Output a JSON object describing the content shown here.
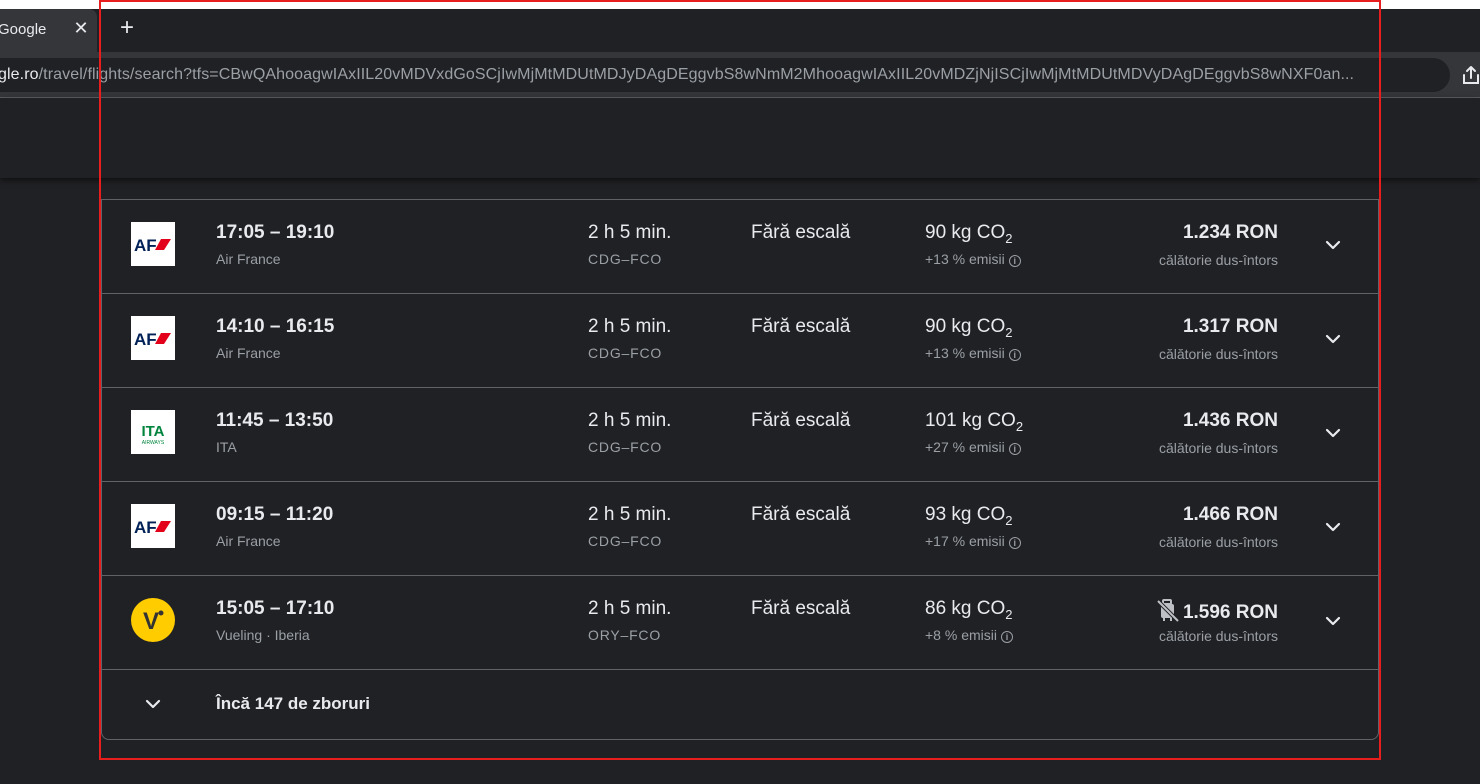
{
  "browser": {
    "tab_title": "Google",
    "tab_close": "✕",
    "new_tab": "+",
    "url_host": "gle.ro",
    "url_path": "/travel/flights/search?tfs=CBwQAhooagwIAxIIL20vMDVxdGoSCjIwMjMtMDUtMDJyDAgDEggvbS8wNmM2MhooagwIAxIIL20vMDZjNjISCjIwMjMtMDUtMDVyDAgDEggvbS8wNXF0an..."
  },
  "flights": [
    {
      "logo": "air-france",
      "times": "17:05 – 19:10",
      "airline": "Air France",
      "duration": "2 h 5 min.",
      "route": "CDG–FCO",
      "stops": "Fără escală",
      "emission_value": "90 kg CO",
      "emission_sub": "2",
      "emission_pct": "+13 % emisii",
      "price": "1.234 RON",
      "price_note": "călătorie dus-întors",
      "no_bag": false
    },
    {
      "logo": "air-france",
      "times": "14:10 – 16:15",
      "airline": "Air France",
      "duration": "2 h 5 min.",
      "route": "CDG–FCO",
      "stops": "Fără escală",
      "emission_value": "90 kg CO",
      "emission_sub": "2",
      "emission_pct": "+13 % emisii",
      "price": "1.317 RON",
      "price_note": "călătorie dus-întors",
      "no_bag": false
    },
    {
      "logo": "ita-airways",
      "times": "11:45 – 13:50",
      "airline": "ITA",
      "duration": "2 h 5 min.",
      "route": "CDG–FCO",
      "stops": "Fără escală",
      "emission_value": "101 kg CO",
      "emission_sub": "2",
      "emission_pct": "+27 % emisii",
      "price": "1.436 RON",
      "price_note": "călătorie dus-întors",
      "no_bag": false
    },
    {
      "logo": "air-france",
      "times": "09:15 – 11:20",
      "airline": "Air France",
      "duration": "2 h 5 min.",
      "route": "CDG–FCO",
      "stops": "Fără escală",
      "emission_value": "93 kg CO",
      "emission_sub": "2",
      "emission_pct": "+17 % emisii",
      "price": "1.466 RON",
      "price_note": "călătorie dus-întors",
      "no_bag": false
    },
    {
      "logo": "vueling",
      "times": "15:05 – 17:10",
      "airline": "Vueling · Iberia",
      "duration": "2 h 5 min.",
      "route": "ORY–FCO",
      "stops": "Fără escală",
      "emission_value": "86 kg CO",
      "emission_sub": "2",
      "emission_pct": "+8 % emisii",
      "price": "1.596 RON",
      "price_note": "călătorie dus-întors",
      "no_bag": true
    }
  ],
  "logos": {
    "af_text": "AF",
    "ita_text": "ITA",
    "ita_sub": "AIRWAYS",
    "vueling_text": "V"
  },
  "more": {
    "label": "Încă 147 de zboruri"
  },
  "colors": {
    "background": "#202124",
    "divider": "#5f6368",
    "annotation_frame": "#e81e1e",
    "af_red": "#e3001b",
    "af_navy": "#002157",
    "ita_green": "#00843d",
    "vueling_yellow": "#ffcc00"
  }
}
